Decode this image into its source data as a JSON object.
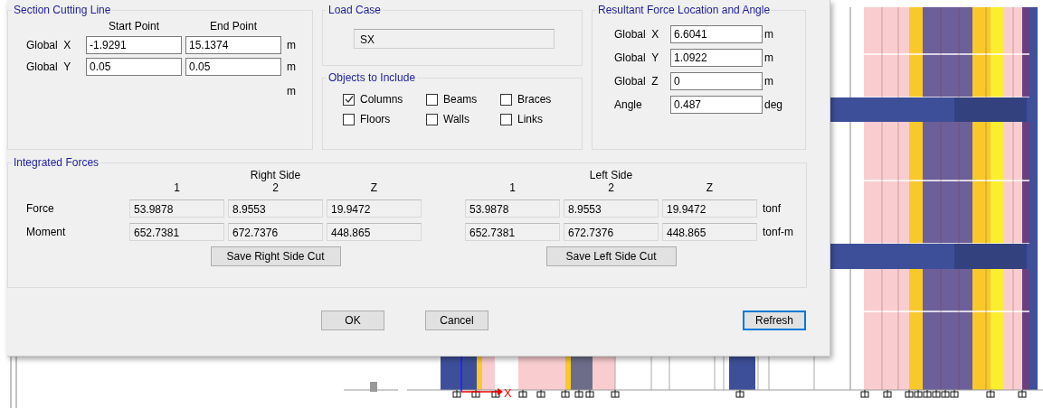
{
  "section_cutting_line": {
    "title": "Section Cutting Line",
    "columns": [
      "Start Point",
      "End Point"
    ],
    "rows": [
      {
        "label": "Global  X",
        "start": "-1.9291",
        "end": "15.1374",
        "unit": "m"
      },
      {
        "label": "Global  Y",
        "start": "0.05",
        "end": "0.05",
        "unit": "m"
      }
    ],
    "extra_unit": "m"
  },
  "load_case": {
    "title": "Load Case",
    "value": "SX"
  },
  "objects_to_include": {
    "title": "Objects to Include",
    "items": [
      {
        "label": "Columns",
        "checked": true
      },
      {
        "label": "Beams",
        "checked": false
      },
      {
        "label": "Braces",
        "checked": false
      },
      {
        "label": "Floors",
        "checked": false
      },
      {
        "label": "Walls",
        "checked": false
      },
      {
        "label": "Links",
        "checked": false
      }
    ]
  },
  "resultant": {
    "title": "Resultant Force Location and Angle",
    "rows": [
      {
        "label": "Global  X",
        "value": "6.6041",
        "unit": "m"
      },
      {
        "label": "Global  Y",
        "value": "1.0922",
        "unit": "m"
      },
      {
        "label": "Global  Z",
        "value": "0",
        "unit": "m"
      },
      {
        "label": "Angle",
        "value": "0.487",
        "unit": "deg"
      }
    ]
  },
  "integrated_forces": {
    "title": "Integrated Forces",
    "row_labels": [
      "Force",
      "Moment"
    ],
    "units": [
      "tonf",
      "tonf-m"
    ],
    "sides": [
      {
        "title": "Right Side",
        "columns": [
          "1",
          "2",
          "Z"
        ],
        "rows": [
          [
            "53.9878",
            "8.9553",
            "19.9472"
          ],
          [
            "652.7381",
            "672.7376",
            "448.865"
          ]
        ],
        "button": "Save Right Side Cut"
      },
      {
        "title": "Left Side",
        "columns": [
          "1",
          "2",
          "Z"
        ],
        "rows": [
          [
            "53.9878",
            "8.9553",
            "19.9472"
          ],
          [
            "652.7381",
            "672.7376",
            "448.865"
          ]
        ],
        "button": "Save Left Side Cut"
      }
    ]
  },
  "buttons": [
    {
      "label": "OK",
      "focused": false
    },
    {
      "label": "Cancel",
      "focused": false
    },
    {
      "label": "Refresh",
      "focused": true
    }
  ],
  "model_view": {
    "axis_label": "X"
  }
}
